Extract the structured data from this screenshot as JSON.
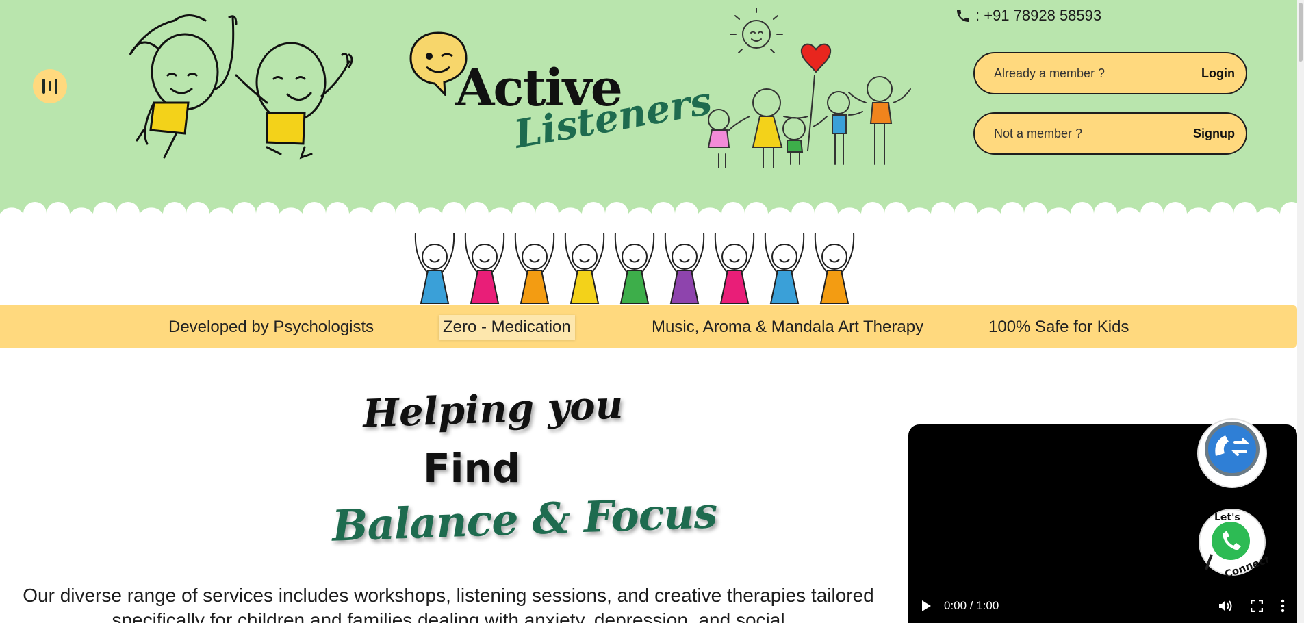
{
  "header": {
    "logo": {
      "word1": "Active",
      "word2": "Listeners"
    },
    "phone": {
      "icon": "phone-icon",
      "text": ": +91 78928 58593"
    },
    "login": {
      "question": "Already a member ?",
      "action": "Login"
    },
    "signup": {
      "question": "Not a member ?",
      "action": "Signup"
    },
    "menu_icon": "menu-bars-icon"
  },
  "features": [
    {
      "label": "Developed by Psychologists"
    },
    {
      "label": "Zero - Medication"
    },
    {
      "label": "Music, Aroma & Mandala Art Therapy"
    },
    {
      "label": "100% Safe for Kids"
    }
  ],
  "hero": {
    "line1": "Helping you",
    "line2": "Find",
    "line3": "Balance & Focus",
    "description": "Our diverse range of services includes workshops, listening sessions, and creative therapies tailored specifically for children and families dealing with anxiety, depression, and social"
  },
  "video": {
    "time": "0:00 / 1:00"
  },
  "fabs": {
    "call_icon": "phone-transfer-icon",
    "whatsapp_text": "Let's Connect"
  },
  "colors": {
    "header_bg": "#b9e5ad",
    "accent_yellow": "#ffd97e",
    "brand_green": "#1e6b4f"
  }
}
